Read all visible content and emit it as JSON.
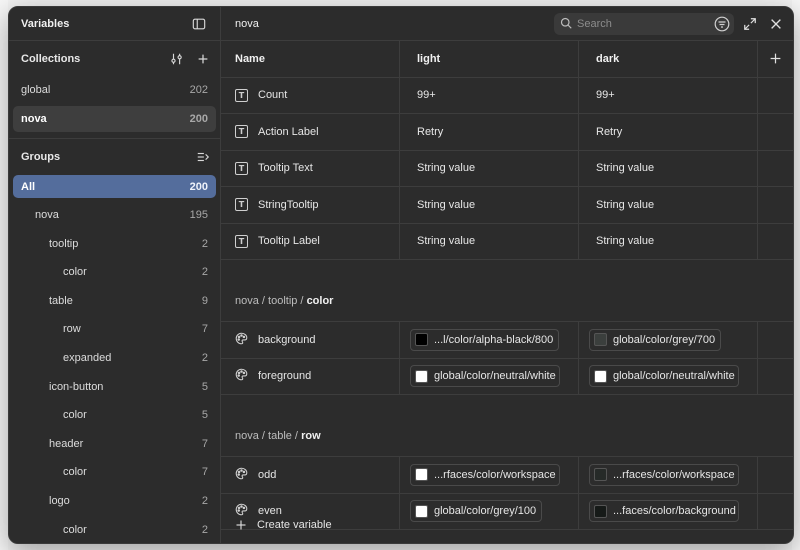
{
  "sidebar": {
    "title": "Variables",
    "collections_title": "Collections",
    "collections": [
      {
        "name": "global",
        "count": "202"
      },
      {
        "name": "nova",
        "count": "200"
      }
    ],
    "groups_title": "Groups",
    "groups": [
      {
        "name": "All",
        "count": "200"
      },
      {
        "name": "nova",
        "count": "195"
      },
      {
        "name": "tooltip",
        "count": "2"
      },
      {
        "name": "color",
        "count": "2"
      },
      {
        "name": "table",
        "count": "9"
      },
      {
        "name": "row",
        "count": "7"
      },
      {
        "name": "expanded",
        "count": "2"
      },
      {
        "name": "icon-button",
        "count": "5"
      },
      {
        "name": "color",
        "count": "5"
      },
      {
        "name": "header",
        "count": "7"
      },
      {
        "name": "color",
        "count": "7"
      },
      {
        "name": "logo",
        "count": "2"
      },
      {
        "name": "color",
        "count": "2"
      }
    ]
  },
  "main": {
    "title": "nova",
    "search_placeholder": "Search",
    "columns": {
      "name": "Name",
      "light": "light",
      "dark": "dark"
    },
    "string_vars": [
      {
        "name": "Count",
        "light": "99+",
        "dark": "99+"
      },
      {
        "name": "Action Label",
        "light": "Retry",
        "dark": "Retry"
      },
      {
        "name": "Tooltip Text",
        "light": "String value",
        "dark": "String value"
      },
      {
        "name": "StringTooltip",
        "light": "String value",
        "dark": "String value"
      },
      {
        "name": "Tooltip Label",
        "light": "String value",
        "dark": "String value"
      }
    ],
    "group1": {
      "path": "nova / tooltip / ",
      "leaf": "color"
    },
    "group1_vars": [
      {
        "name": "background",
        "light": "...l/color/alpha-black/800",
        "light_color": "#000000",
        "dark": "global/color/grey/700",
        "dark_color": "#3b3f3d"
      },
      {
        "name": "foreground",
        "light": "global/color/neutral/white",
        "light_color": "#ffffff",
        "dark": "global/color/neutral/white",
        "dark_color": "#ffffff"
      }
    ],
    "group2": {
      "path": "nova / table / ",
      "leaf": "row"
    },
    "group2_vars": [
      {
        "name": "odd",
        "light": "...rfaces/color/workspace",
        "light_color": "#ffffff",
        "dark": "...rfaces/color/workspace",
        "dark_color": "#262a28"
      },
      {
        "name": "even",
        "light": "global/color/grey/100",
        "light_color": "#ffffff",
        "dark": "...faces/color/background",
        "dark_color": "#161a18"
      }
    ],
    "create_label": "Create variable"
  }
}
